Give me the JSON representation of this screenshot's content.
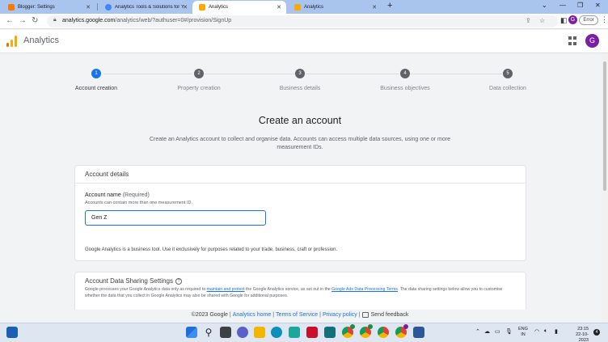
{
  "browser": {
    "tabs": [
      {
        "title": "Blogger: Settings",
        "favicon_color": "#f57c00"
      },
      {
        "title": "Analytics Tools & Solutions for Y",
        "favicon_color": "#4285f4"
      },
      {
        "title": "Analytics",
        "favicon_color": "#f9ab00"
      },
      {
        "title": "Analytics",
        "favicon_color": "#f9ab00"
      }
    ],
    "active_tab_index": 2,
    "url_host": "analytics.google.com",
    "url_path": "/analytics/web/?authuser=0#/provision/SignUp",
    "profile_initial": "G",
    "error_label": "Error"
  },
  "app": {
    "title": "Analytics",
    "account_initial": "G"
  },
  "stepper": {
    "steps": [
      {
        "num": "1",
        "label": "Account creation",
        "active": true
      },
      {
        "num": "2",
        "label": "Property creation",
        "active": false
      },
      {
        "num": "3",
        "label": "Business details",
        "active": false
      },
      {
        "num": "4",
        "label": "Business objectives",
        "active": false
      },
      {
        "num": "5",
        "label": "Data collection",
        "active": false
      }
    ]
  },
  "main": {
    "headline": "Create an account",
    "subtext": "Create an Analytics account to collect and organise data. Accounts can access multiple data sources, using one or more measurement IDs."
  },
  "account_details": {
    "title": "Account details",
    "field_label": "Account name",
    "field_required": "(Required)",
    "field_help": "Accounts can contain more than one measurement ID.",
    "field_value": "Gen Z",
    "disclaimer": "Google Analytics is a business tool. Use it exclusively for purposes related to your trade, business, craft or profession."
  },
  "data_sharing": {
    "title": "Account Data Sharing Settings",
    "text_1": "Google processes your Google Analytics data only as required to ",
    "link_1": "maintain and protect",
    "text_2": " the Google Analytics service, as set out in the ",
    "link_2": "Google Ads Data Processing Terms",
    "text_3": ". The data sharing settings below allow you to customise whether the data that you collect in Google Analytics may also be shared with Google for additional purposes."
  },
  "footer": {
    "copyright": "©2023 Google",
    "links": [
      "Analytics home",
      "Terms of Service",
      "Privacy policy"
    ],
    "feedback": "Send feedback"
  },
  "taskbar": {
    "apps": [
      {
        "name": "windows-start-icon",
        "color": "#1e6fd9"
      },
      {
        "name": "search-icon",
        "color": "#202124"
      },
      {
        "name": "task-view-icon",
        "color": "#202124"
      },
      {
        "name": "teams-chat-icon",
        "color": "#5b5fc7"
      },
      {
        "name": "file-explorer-icon",
        "color": "#f2b600"
      },
      {
        "name": "edge-icon",
        "color": "#0c8fbd"
      },
      {
        "name": "l-app-icon",
        "color": "#1aa89c"
      },
      {
        "name": "mcafee-icon",
        "color": "#c8102e"
      },
      {
        "name": "mosaic-app-icon",
        "color": "#12707a"
      },
      {
        "name": "chrome-icon",
        "color": "#db4437"
      },
      {
        "name": "chrome-icon",
        "color": "#0f9d58"
      },
      {
        "name": "chrome-icon",
        "color": "#f4b400"
      },
      {
        "name": "chrome-icon",
        "color": "#4285f4"
      },
      {
        "name": "word-icon",
        "color": "#2b579a"
      }
    ],
    "lang_top": "ENG",
    "lang_bottom": "IN",
    "time": "23:15",
    "date": "22-10-2023",
    "notifications": "4"
  },
  "colors": {
    "accent": "#1a73e8",
    "ga_orange": "#f9ab00",
    "ga_dark_orange": "#e37400"
  }
}
